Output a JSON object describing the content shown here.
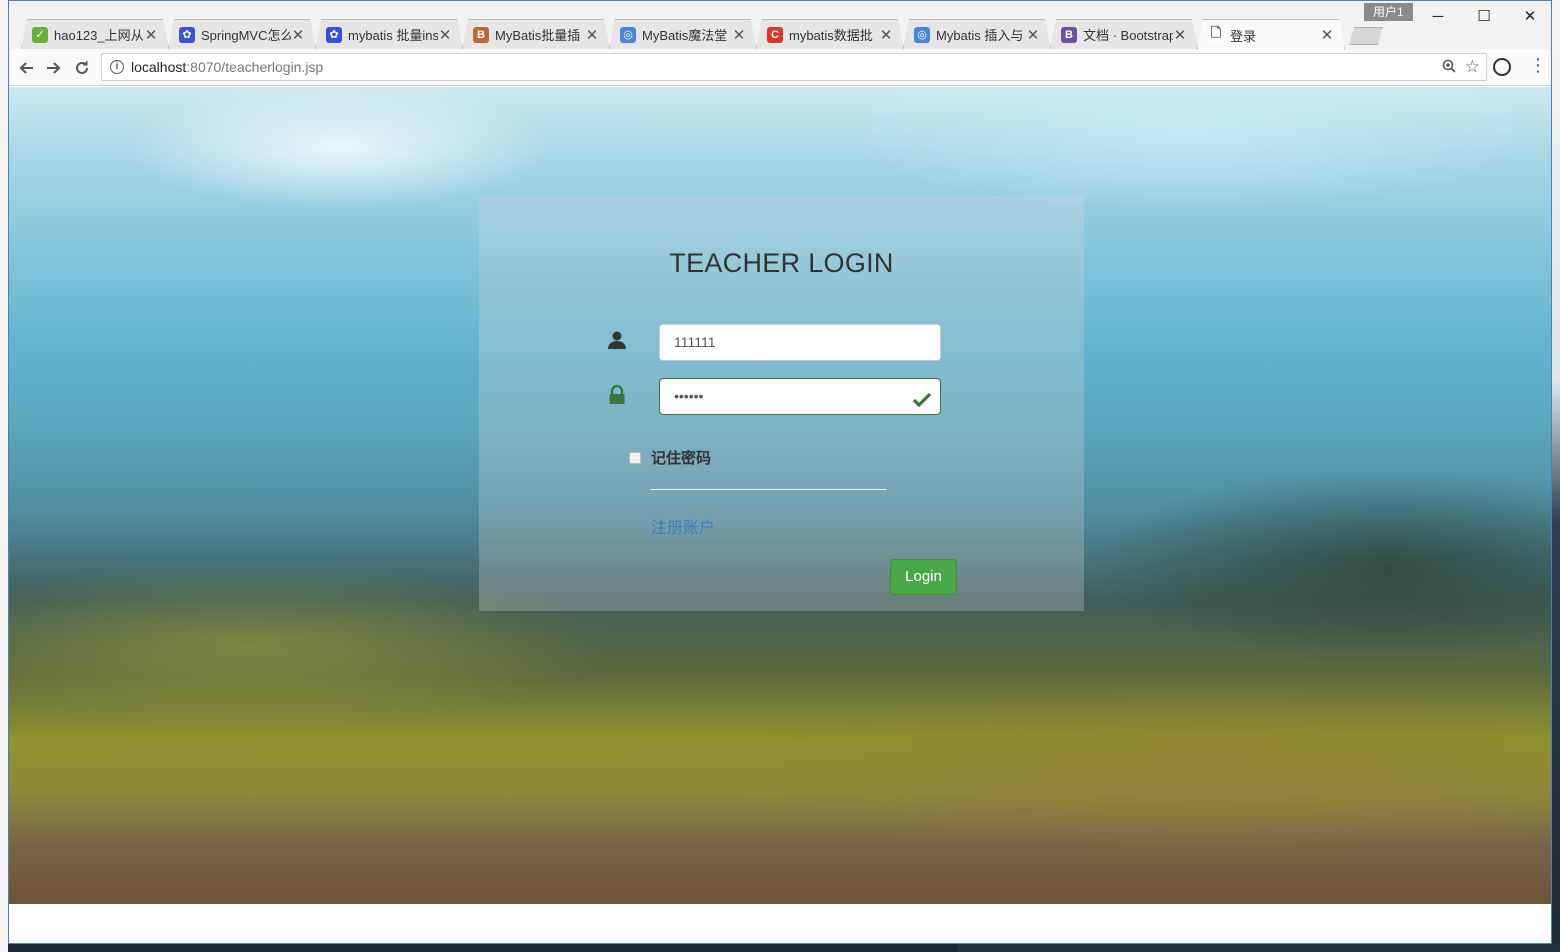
{
  "browser": {
    "user_badge": "用户1",
    "tabs": [
      {
        "title": "hao123_上网从",
        "favicon": "hao123-icon",
        "color": "#6cae3e",
        "glyph": "✓"
      },
      {
        "title": "SpringMVC怎么",
        "favicon": "baidu-paw-icon",
        "color": "#3852d8",
        "glyph": "✿"
      },
      {
        "title": "mybatis 批量ins",
        "favicon": "baidu-paw-icon",
        "color": "#3852d8",
        "glyph": "✿"
      },
      {
        "title": "MyBatis批量插",
        "favicon": "jb-icon",
        "color": "#c0643a",
        "glyph": "B"
      },
      {
        "title": "MyBatis魔法堂",
        "favicon": "cnblogs-icon",
        "color": "#4a86d8",
        "glyph": "◎"
      },
      {
        "title": "mybatis数据批",
        "favicon": "csdn-icon",
        "color": "#d9372a",
        "glyph": "C"
      },
      {
        "title": "Mybatis 插入与",
        "favicon": "cnblogs-icon",
        "color": "#4a86d8",
        "glyph": "◎"
      },
      {
        "title": "文档 · Bootstrap",
        "favicon": "bootstrap-icon",
        "color": "#6d4fa0",
        "glyph": "B"
      },
      {
        "title": "登录",
        "favicon": "page-icon",
        "color": "#ffffff",
        "glyph": "🗋"
      }
    ],
    "active_tab": 8,
    "url_host": "localhost",
    "url_rest": ":8070/teacherlogin.jsp"
  },
  "login": {
    "title": "TEACHER LOGIN",
    "username_value": "111111",
    "password_value": "••••••",
    "remember_label": "记住密码",
    "register_link": "注册账户",
    "submit_label": "Login"
  },
  "colors": {
    "success": "#3c763d",
    "button": "#4aa84b",
    "link": "#3a7ec0"
  }
}
